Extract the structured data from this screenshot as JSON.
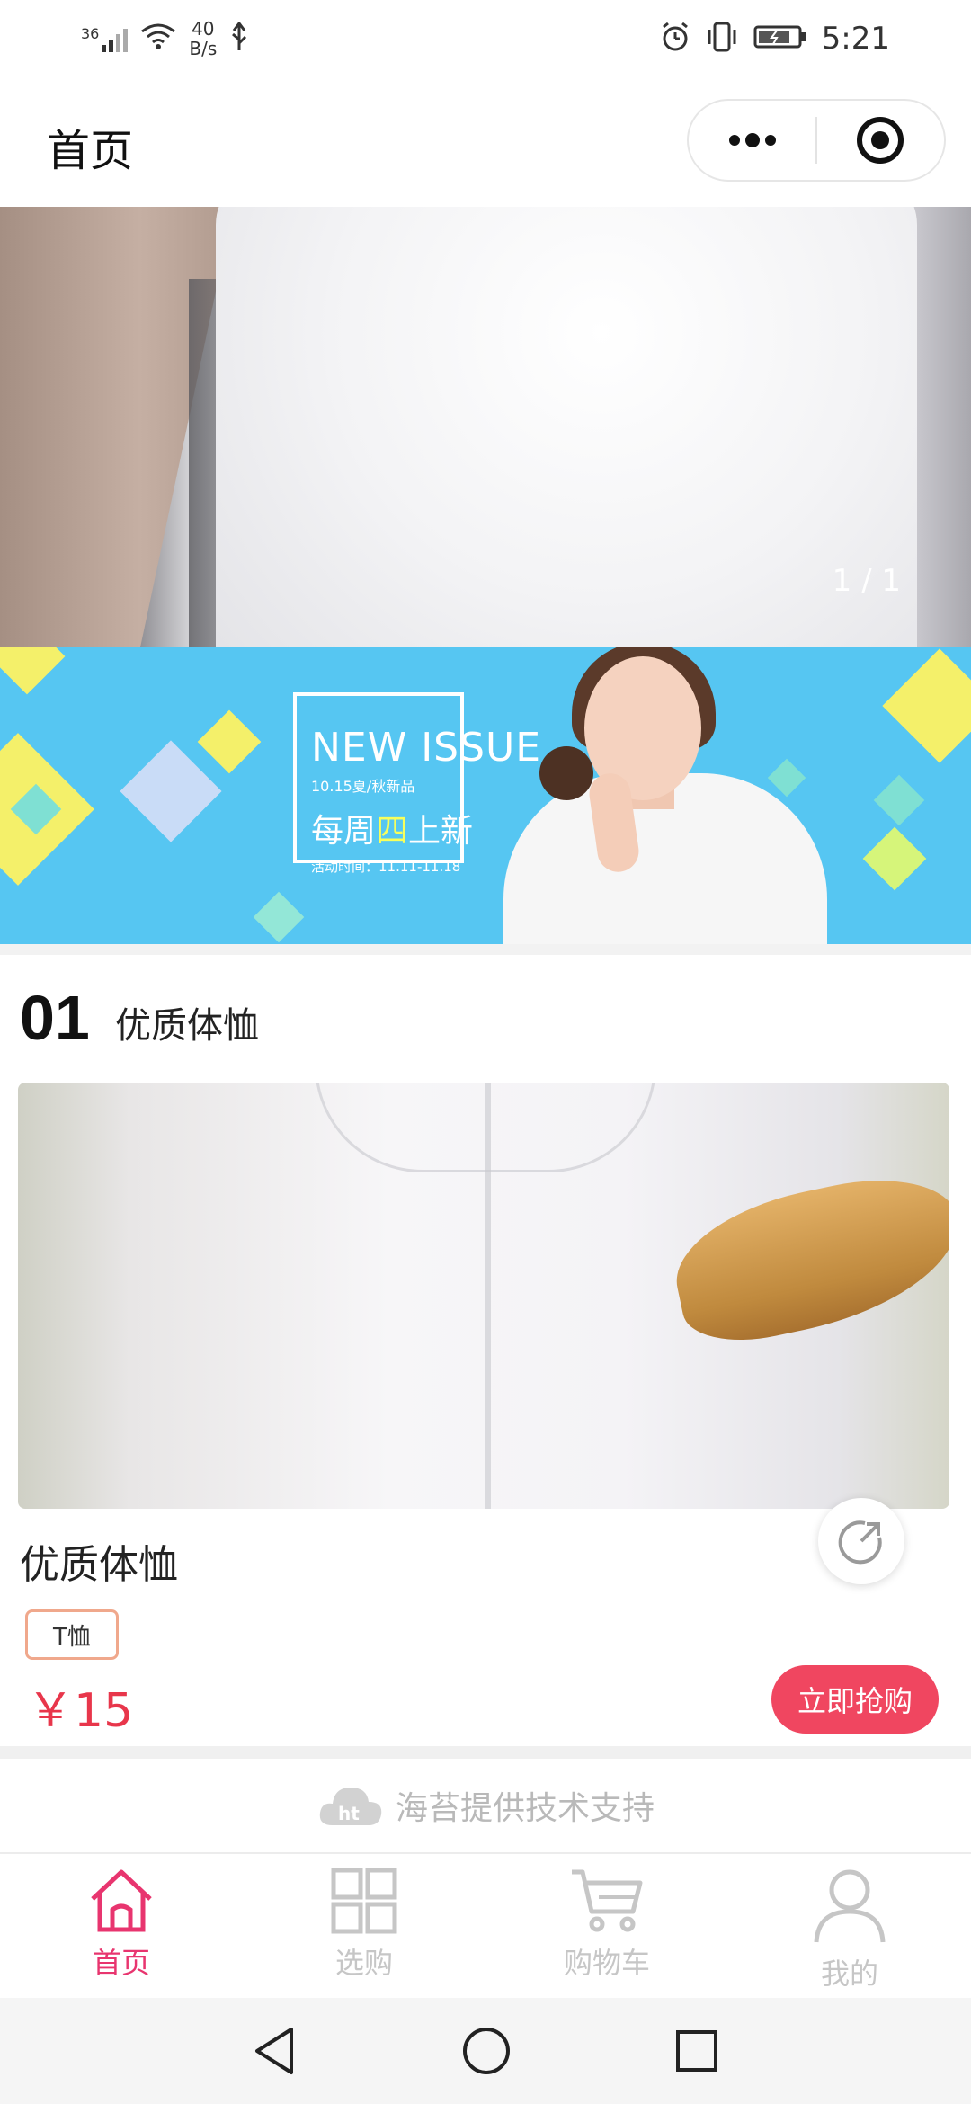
{
  "status_bar": {
    "network": "36",
    "speed_value": "40",
    "speed_unit": "B/s",
    "time": "5:21"
  },
  "nav": {
    "title": "首页",
    "more_icon": "more-dots-icon",
    "close_icon": "target-close-icon"
  },
  "banner": {
    "indicator": "1 / 1"
  },
  "promo": {
    "headline_en": "NEW ISSUE",
    "subline": "10.15夏/秋新品",
    "headline_cn_pre": "每周",
    "headline_cn_hl": "四",
    "headline_cn_post": "上新",
    "activity_time": "活动时间：11.11-11.18"
  },
  "section": {
    "number": "01",
    "title": "优质体恤"
  },
  "product": {
    "name": "优质体恤",
    "tag": "T恤",
    "price": "￥15",
    "buy_label": "立即抢购",
    "share_icon": "share-icon"
  },
  "footer": {
    "tech_support": "海苔提供技术支持"
  },
  "tabs": [
    {
      "label": "首页",
      "icon": "home-icon",
      "active": true
    },
    {
      "label": "选购",
      "icon": "grid-icon",
      "active": false
    },
    {
      "label": "购物车",
      "icon": "cart-icon",
      "active": false
    },
    {
      "label": "我的",
      "icon": "user-icon",
      "active": false
    }
  ],
  "colors": {
    "accent": "#e8356f",
    "price": "#e8364b",
    "buy_button": "#f04660",
    "promo_bg": "#56c6f2"
  }
}
